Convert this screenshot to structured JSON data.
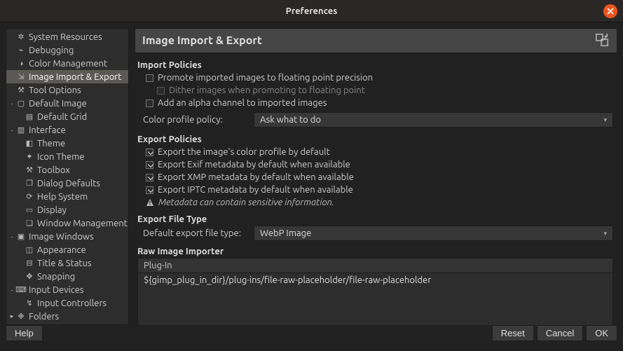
{
  "window": {
    "title": "Preferences"
  },
  "sidebar": {
    "items": [
      {
        "label": "System Resources",
        "icon": "chip",
        "depth": 0,
        "expander": "",
        "selected": false
      },
      {
        "label": "Debugging",
        "icon": "bug",
        "depth": 0,
        "expander": "",
        "selected": false
      },
      {
        "label": "Color Management",
        "icon": "palette",
        "depth": 0,
        "expander": "",
        "selected": false
      },
      {
        "label": "Image Import & Export",
        "icon": "import",
        "depth": 0,
        "expander": "",
        "selected": true
      },
      {
        "label": "Tool Options",
        "icon": "wrench",
        "depth": 0,
        "expander": "",
        "selected": false
      },
      {
        "label": "Default Image",
        "icon": "image",
        "depth": 0,
        "expander": "-",
        "selected": false
      },
      {
        "label": "Default Grid",
        "icon": "grid",
        "depth": 1,
        "expander": "",
        "selected": false
      },
      {
        "label": "Interface",
        "icon": "interface",
        "depth": 0,
        "expander": "-",
        "selected": false
      },
      {
        "label": "Theme",
        "icon": "theme",
        "depth": 1,
        "expander": "",
        "selected": false
      },
      {
        "label": "Icon Theme",
        "icon": "icons",
        "depth": 1,
        "expander": "",
        "selected": false
      },
      {
        "label": "Toolbox",
        "icon": "toolbox",
        "depth": 1,
        "expander": "",
        "selected": false
      },
      {
        "label": "Dialog Defaults",
        "icon": "dialog",
        "depth": 1,
        "expander": "",
        "selected": false
      },
      {
        "label": "Help System",
        "icon": "help",
        "depth": 1,
        "expander": "",
        "selected": false
      },
      {
        "label": "Display",
        "icon": "display",
        "depth": 1,
        "expander": "",
        "selected": false
      },
      {
        "label": "Window Management",
        "icon": "windows",
        "depth": 1,
        "expander": "",
        "selected": false
      },
      {
        "label": "Image Windows",
        "icon": "imgwin",
        "depth": 0,
        "expander": "-",
        "selected": false
      },
      {
        "label": "Appearance",
        "icon": "appearance",
        "depth": 1,
        "expander": "",
        "selected": false
      },
      {
        "label": "Title & Status",
        "icon": "title",
        "depth": 1,
        "expander": "",
        "selected": false
      },
      {
        "label": "Snapping",
        "icon": "snap",
        "depth": 1,
        "expander": "",
        "selected": false
      },
      {
        "label": "Input Devices",
        "icon": "input",
        "depth": 0,
        "expander": "-",
        "selected": false
      },
      {
        "label": "Input Controllers",
        "icon": "controller",
        "depth": 1,
        "expander": "",
        "selected": false
      },
      {
        "label": "Folders",
        "icon": "folder",
        "depth": 0,
        "expander": "▸",
        "selected": false
      }
    ]
  },
  "panel": {
    "title": "Image Import & Export",
    "import": {
      "heading": "Import Policies",
      "promote": {
        "label": "Promote imported images to floating point precision",
        "checked": false
      },
      "dither": {
        "label": "Dither images when promoting to floating point",
        "checked": false,
        "disabled": true
      },
      "alpha": {
        "label": "Add an alpha channel to imported images",
        "checked": false
      },
      "color_policy_label": "Color profile policy:",
      "color_policy_value": "Ask what to do"
    },
    "export": {
      "heading": "Export Policies",
      "color_profile": {
        "label": "Export the image's color profile by default",
        "checked": true
      },
      "exif": {
        "label": "Export Exif metadata by default when available",
        "checked": true
      },
      "xmp": {
        "label": "Export XMP metadata by default when available",
        "checked": true
      },
      "iptc": {
        "label": "Export IPTC metadata by default when available",
        "checked": true
      },
      "warning": "Metadata can contain sensitive information."
    },
    "filetype": {
      "heading": "Export File Type",
      "label": "Default export file type:",
      "value": "WebP Image"
    },
    "raw": {
      "heading": "Raw Image Importer",
      "column": "Plug-In",
      "value": "${gimp_plug_in_dir}/plug-ins/file-raw-placeholder/file-raw-placeholder"
    }
  },
  "buttons": {
    "help": "Help",
    "reset": "Reset",
    "cancel": "Cancel",
    "ok": "OK"
  }
}
